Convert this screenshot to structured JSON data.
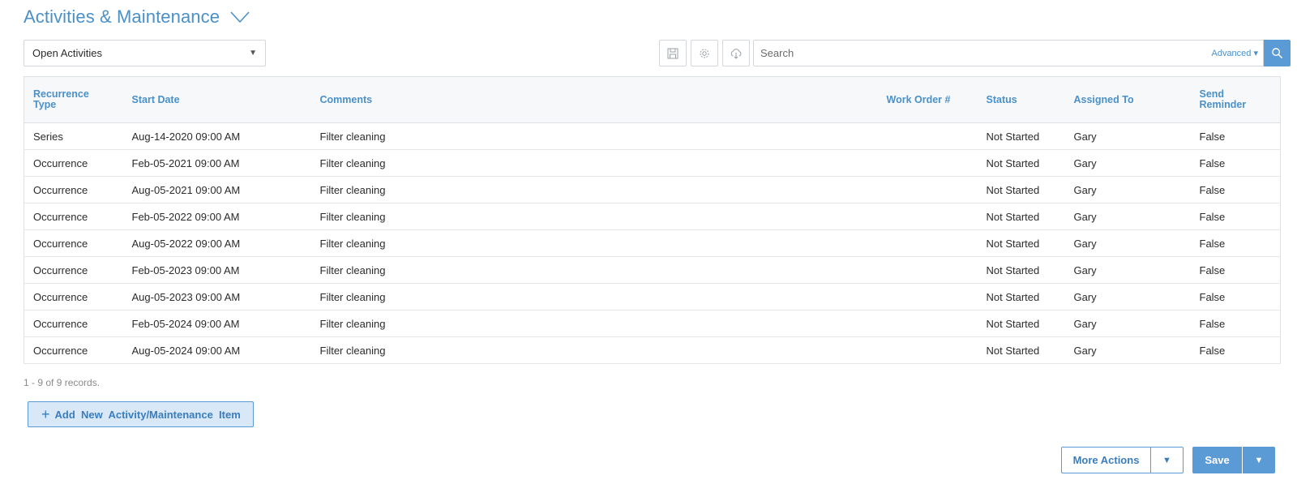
{
  "header": {
    "title": "Activities & Maintenance"
  },
  "toolbar": {
    "view_select_value": "Open Activities",
    "search_placeholder": "Search",
    "advanced_label": "Advanced"
  },
  "table": {
    "columns": [
      "Recurrence Type",
      "Start Date",
      "Comments",
      "Work Order #",
      "Status",
      "Assigned To",
      "Send Reminder"
    ],
    "rows": [
      [
        "Series",
        "Aug-14-2020 09:00 AM",
        "Filter cleaning",
        "",
        "Not Started",
        "Gary",
        "False"
      ],
      [
        "Occurrence",
        "Feb-05-2021 09:00 AM",
        "Filter cleaning",
        "",
        "Not Started",
        "Gary",
        "False"
      ],
      [
        "Occurrence",
        "Aug-05-2021 09:00 AM",
        "Filter cleaning",
        "",
        "Not Started",
        "Gary",
        "False"
      ],
      [
        "Occurrence",
        "Feb-05-2022 09:00 AM",
        "Filter cleaning",
        "",
        "Not Started",
        "Gary",
        "False"
      ],
      [
        "Occurrence",
        "Aug-05-2022 09:00 AM",
        "Filter cleaning",
        "",
        "Not Started",
        "Gary",
        "False"
      ],
      [
        "Occurrence",
        "Feb-05-2023 09:00 AM",
        "Filter cleaning",
        "",
        "Not Started",
        "Gary",
        "False"
      ],
      [
        "Occurrence",
        "Aug-05-2023 09:00 AM",
        "Filter cleaning",
        "",
        "Not Started",
        "Gary",
        "False"
      ],
      [
        "Occurrence",
        "Feb-05-2024 09:00 AM",
        "Filter cleaning",
        "",
        "Not Started",
        "Gary",
        "False"
      ],
      [
        "Occurrence",
        "Aug-05-2024 09:00 AM",
        "Filter cleaning",
        "",
        "Not Started",
        "Gary",
        "False"
      ]
    ]
  },
  "footer": {
    "records_text": "1 - 9 of 9 records.",
    "add_label": "Add  New  Activity/Maintenance  Item",
    "more_actions_label": "More Actions",
    "save_label": "Save"
  },
  "colors": {
    "accent": "#4a90c9",
    "primary_button": "#5b9bd5"
  }
}
